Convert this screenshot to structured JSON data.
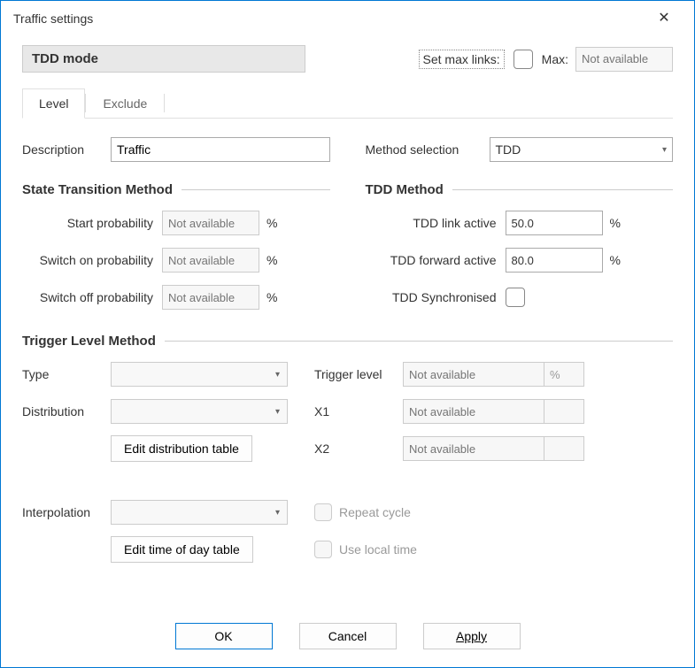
{
  "window": {
    "title": "Traffic settings"
  },
  "topRow": {
    "modeLabel": "TDD mode",
    "setMaxLinksLabel": "Set max links:",
    "maxLabel": "Max:",
    "maxPlaceholder": "Not available"
  },
  "tabs": {
    "level": "Level",
    "exclude": "Exclude"
  },
  "desc": {
    "label": "Description",
    "value": "Traffic"
  },
  "method": {
    "label": "Method selection",
    "value": "TDD"
  },
  "stm": {
    "title": "State Transition Method",
    "startProb": {
      "label": "Start probability",
      "value": "Not available"
    },
    "switchOnProb": {
      "label": "Switch on probability",
      "value": "Not available"
    },
    "switchOffProb": {
      "label": "Switch off probability",
      "value": "Not available"
    },
    "unit": "%"
  },
  "tdd": {
    "title": "TDD Method",
    "linkActive": {
      "label": "TDD link active",
      "value": "50.0"
    },
    "forwardActive": {
      "label": "TDD forward active",
      "value": "80.0"
    },
    "synchronised": {
      "label": "TDD Synchronised"
    },
    "unit": "%"
  },
  "trigger": {
    "title": "Trigger Level Method",
    "typeLabel": "Type",
    "distributionLabel": "Distribution",
    "editDistBtn": "Edit distribution table",
    "triggerLevelLabel": "Trigger level",
    "triggerLevelValue": "Not available",
    "triggerLevelUnit": "%",
    "x1Label": "X1",
    "x1Value": "Not available",
    "x2Label": "X2",
    "x2Value": "Not available"
  },
  "interp": {
    "label": "Interpolation",
    "editTimeBtn": "Edit time of day table",
    "repeatCycleLabel": "Repeat cycle",
    "useLocalTimeLabel": "Use local time"
  },
  "footer": {
    "ok": "OK",
    "cancel": "Cancel",
    "apply": "Apply"
  }
}
